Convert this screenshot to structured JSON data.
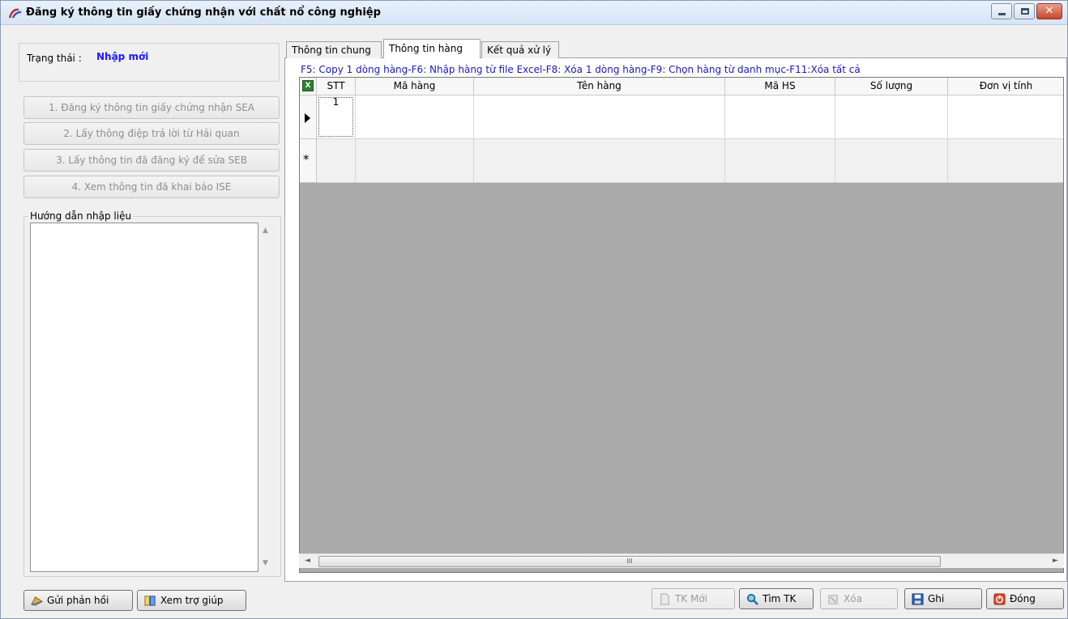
{
  "window": {
    "title": "Đăng ký thông tin giấy chứng nhận với chất nổ công nghiệp",
    "close_glyph": "✕"
  },
  "status": {
    "label": "Trạng thái :",
    "value": "Nhập mới"
  },
  "steps": [
    {
      "label": "1. Đăng ký thông tin giấy chứng nhận  SEA"
    },
    {
      "label": "2. Lấy thông điệp trả lời từ Hải quan"
    },
    {
      "label": "3. Lấy thông tin đã đăng ký để sửa SEB"
    },
    {
      "label": "4. Xem thông tin đã khai báo ISE"
    }
  ],
  "guide": {
    "title": "Hướng dẫn nhập liệu",
    "scroll_up": "▲",
    "scroll_down": "▼"
  },
  "tabs": [
    {
      "label": "Thông tin chung"
    },
    {
      "label": "Thông tin hàng"
    },
    {
      "label": "Kết quả xử lý"
    }
  ],
  "hint": "F5: Copy 1 dòng hàng-F6: Nhập hàng từ file Excel-F8: Xóa 1 dòng hàng-F9: Chọn hàng từ danh mục-F11:Xóa tất cả",
  "grid": {
    "excel_label": "X",
    "columns": [
      "STT",
      "Mã hàng",
      "Tên hàng",
      "Mã HS",
      "Số lượng",
      "Đơn vị tính"
    ],
    "rows": [
      {
        "stt": "1",
        "ma_hang": "",
        "ten_hang": "",
        "ma_hs": "",
        "so_luong": "",
        "don_vi_tinh": ""
      }
    ],
    "new_row_marker": "*",
    "scroll_left": "◄",
    "scroll_right": "►",
    "scroll_thumb": "III"
  },
  "footer": {
    "send_feedback": "Gửi phản hồi",
    "help": "Xem trợ giúp",
    "new_declaration": "TK Mới",
    "find_declaration": "Tìm TK",
    "delete": "Xóa",
    "save": "Ghi",
    "close": "Đóng"
  }
}
